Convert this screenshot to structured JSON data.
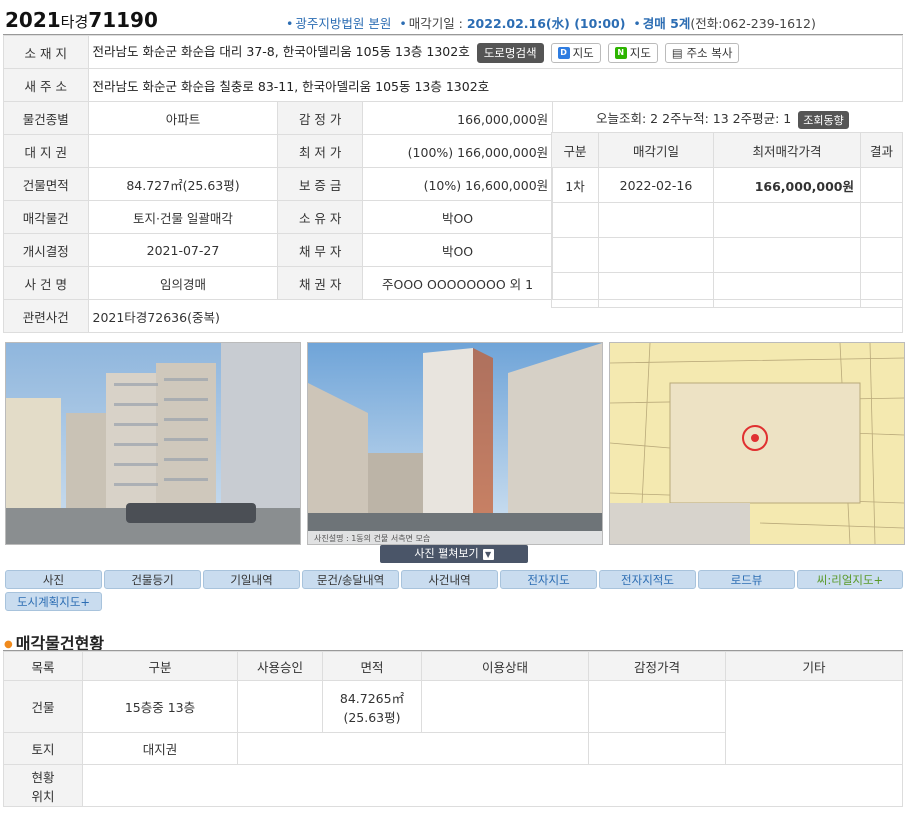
{
  "header": {
    "case_year": "2021",
    "case_type": "타경",
    "case_no": "71190",
    "court": "광주지방법원 본원",
    "sale_date_label": "매각기일 : ",
    "sale_date": "2022.02.16(水) (10:00)",
    "dept": "경매 5계",
    "phone": "(전화:062-239-1612)"
  },
  "info": {
    "address_label": "소 재 지",
    "address": "전라남도 화순군 화순읍 대리 37-8, 한국아델리움 105동 13층 1302호",
    "road_search": "도로명검색",
    "map1": "지도",
    "map2": "지도",
    "copy_addr": "주소 복사",
    "new_address_label": "새 주 소",
    "new_address": "전라남도 화순군 화순읍 칠충로 83-11, 한국아델리움 105동 13층 1302호",
    "rows": [
      {
        "l1": "물건종별",
        "v1": "아파트",
        "l2": "감 정 가",
        "v2": "166,000,000원"
      },
      {
        "l1": "대 지 권",
        "v1": "",
        "l2": "최 저 가",
        "v2": "(100%) 166,000,000원"
      },
      {
        "l1": "건물면적",
        "v1": "84.727㎡(25.63평)",
        "l2": "보 증 금",
        "v2": "(10%) 16,600,000원"
      },
      {
        "l1": "매각물건",
        "v1": "토지·건물 일괄매각",
        "l2": "소 유 자",
        "v2": "박OO"
      },
      {
        "l1": "개시결정",
        "v1": "2021-07-27",
        "l2": "채 무 자",
        "v2": "박OO"
      },
      {
        "l1": "사 건 명",
        "v1": "임의경매",
        "l2": "채 권 자",
        "v2": "주OOO OOOOOOOO 외 1"
      }
    ],
    "related_label": "관련사건",
    "related": "2021타경72636(중복)"
  },
  "views": {
    "today": "오늘조회: 2",
    "two_week": "2주누적: 13",
    "avg": "2주평균: 1",
    "btn": "조회동향"
  },
  "history": {
    "headers": [
      "구분",
      "매각기일",
      "최저매각가격",
      "결과"
    ],
    "rows": [
      {
        "round": "1차",
        "date": "2022-02-16",
        "price": "166,000,000원",
        "result": ""
      }
    ]
  },
  "photos": {
    "expand": "사진 펼쳐보기",
    "caption2": "사진설명 : 1동의 건물 서측면 모습"
  },
  "tabs": [
    "사진",
    "건물등기",
    "기일내역",
    "문건/송달내역",
    "사건내역",
    "전자지도",
    "전자지적도",
    "로드뷰",
    "씨:리얼지도+",
    "도시계획지도+"
  ],
  "section": {
    "title": "매각물건현황",
    "headers": [
      "목록",
      "구분",
      "사용승인",
      "면적",
      "이용상태",
      "감정가격",
      "기타"
    ],
    "building_label": "건물",
    "building_type": "15층중 13층",
    "area1": "84.7265㎡",
    "area2": "(25.63평)",
    "land_label": "토지",
    "land_type": "대지권",
    "loc_label1": "현황",
    "loc_label2": "위치"
  },
  "colors": {
    "accent": "#2c6db3",
    "label_bg": "#f3f3f3",
    "tab_bg": "#c9dcef",
    "bullet": "#f08a1c"
  }
}
